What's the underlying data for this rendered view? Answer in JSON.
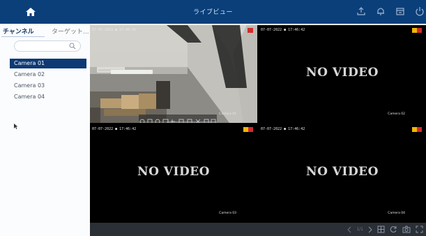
{
  "header": {
    "title": "ライブビュー",
    "icons": [
      "home-icon",
      "export-icon",
      "bell-icon",
      "archive-icon",
      "power-icon"
    ]
  },
  "sidebar": {
    "tabs": [
      {
        "label": "チャンネル"
      },
      {
        "label": "ターゲット..."
      }
    ],
    "search": {
      "placeholder": ""
    },
    "cameras": [
      "Camera 01",
      "Camera 02",
      "Camera 03",
      "Camera 04"
    ],
    "selected": "Camera 01"
  },
  "tiles": [
    {
      "timestamp": "07-07-2022 ● 17:46:42",
      "label": "Camera 01",
      "status": "live"
    },
    {
      "timestamp": "07-07-2022 ● 17:46:42",
      "label": "Camera 02",
      "status": "NO VIDEO"
    },
    {
      "timestamp": "07-07-2022 ● 17:46:42",
      "label": "Camera 03",
      "status": "NO VIDEO"
    },
    {
      "timestamp": "07-07-2022 ● 17:46:42",
      "label": "Camera 04",
      "status": "NO VIDEO"
    }
  ],
  "bottombar": {
    "page": "1/1"
  },
  "colors": {
    "header": "#0a3f7a",
    "selected": "#0d3a74",
    "rec": "#d32b2b",
    "motion": "#f2b705"
  }
}
